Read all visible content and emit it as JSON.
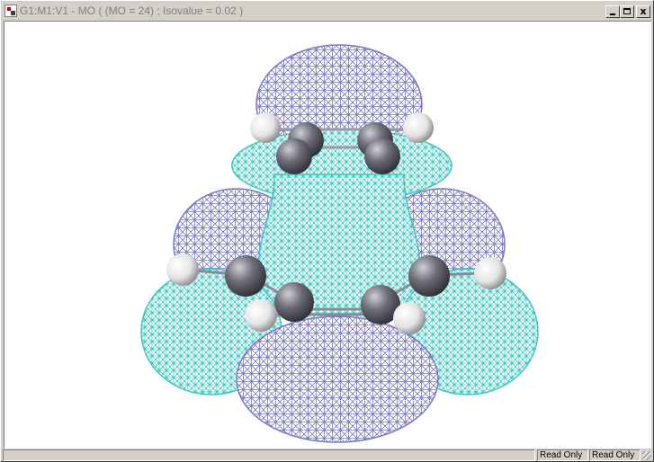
{
  "window": {
    "title": "G1:M1:V1 - MO ( (MO = 24) ; Isovalue = 0.02 )",
    "controls": {
      "minimize": "_",
      "maximize": "□",
      "close": "x"
    }
  },
  "viewport": {
    "content": "molecular-orbital-isosurface",
    "colors": {
      "positive_lobe": "#7a78c0",
      "negative_lobe": "#3cc6c0",
      "atom_carbon": "#6a6a72",
      "atom_hydrogen": "#f0f0f0",
      "background": "#ffffff"
    }
  },
  "statusbar": {
    "cells": [
      "Read Only",
      "Read Only"
    ]
  }
}
